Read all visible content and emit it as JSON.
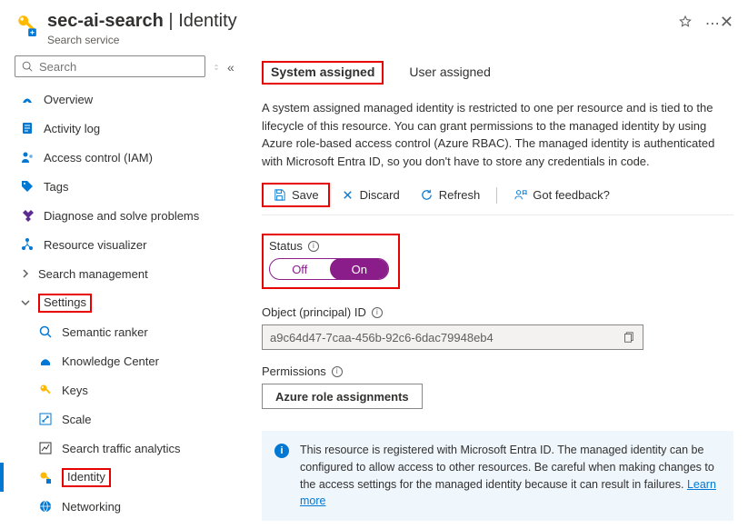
{
  "header": {
    "resource_name": "sec-ai-search",
    "section": "Identity",
    "subtitle": "Search service"
  },
  "sidebar": {
    "search_placeholder": "Search",
    "items": {
      "overview": "Overview",
      "activity_log": "Activity log",
      "access_control": "Access control (IAM)",
      "tags": "Tags",
      "diagnose": "Diagnose and solve problems",
      "resource_visualizer": "Resource visualizer",
      "search_management": "Search management",
      "settings": "Settings",
      "semantic_ranker": "Semantic ranker",
      "knowledge_center": "Knowledge Center",
      "keys": "Keys",
      "scale": "Scale",
      "traffic_analytics": "Search traffic analytics",
      "identity": "Identity",
      "networking": "Networking"
    }
  },
  "tabs": {
    "system_assigned": "System assigned",
    "user_assigned": "User assigned"
  },
  "description": "A system assigned managed identity is restricted to one per resource and is tied to the lifecycle of this resource. You can grant permissions to the managed identity by using Azure role-based access control (Azure RBAC). The managed identity is authenticated with Microsoft Entra ID, so you don't have to store any credentials in code.",
  "toolbar": {
    "save": "Save",
    "discard": "Discard",
    "refresh": "Refresh",
    "feedback": "Got feedback?"
  },
  "status": {
    "label": "Status",
    "off": "Off",
    "on": "On"
  },
  "object_id": {
    "label": "Object (principal) ID",
    "value": "a9c64d47-7caa-456b-92c6-6dac79948eb4"
  },
  "permissions": {
    "label": "Permissions",
    "button": "Azure role assignments"
  },
  "banner": {
    "text": "This resource is registered with Microsoft Entra ID. The managed identity can be configured to allow access to other resources. Be careful when making changes to the access settings for the managed identity because it can result in failures. ",
    "link": "Learn more"
  }
}
